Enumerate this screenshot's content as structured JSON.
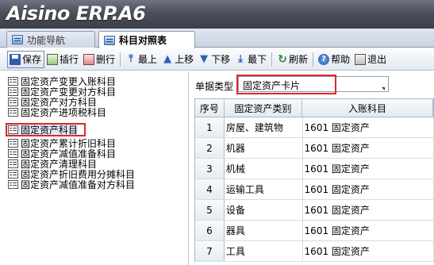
{
  "app": {
    "logo": "Aisino ERP.A6"
  },
  "tabs": [
    {
      "label": "功能导航"
    },
    {
      "label": "科目对照表"
    }
  ],
  "toolbar": {
    "save": "保存",
    "insert": "插行",
    "delete": "删行",
    "top": "最上",
    "up": "上移",
    "down": "下移",
    "bottom": "最下",
    "refresh": "刷新",
    "help": "帮助",
    "exit": "退出"
  },
  "tree": {
    "items": [
      "固定资产变更入账科目",
      "固定资产变更对方科目",
      "固定资产对方科目",
      "固定资产进项税科目",
      "固定资产科目",
      "固定资产累计折旧科目",
      "固定资产减值准备科目",
      "固定资产清理科目",
      "固定资产折旧费用分摊科目",
      "固定资产减值准备对方科目"
    ],
    "selected_index": 4
  },
  "form": {
    "doc_type_label": "单据类型",
    "doc_type_value": "固定资产卡片"
  },
  "grid": {
    "headers": [
      "序号",
      "固定资产类别",
      "入账科目"
    ],
    "rows": [
      [
        "1",
        "房屋、建筑物",
        "1601 固定资产"
      ],
      [
        "2",
        "机器",
        "1601 固定资产"
      ],
      [
        "3",
        "机械",
        "1601 固定资产"
      ],
      [
        "4",
        "运输工具",
        "1601 固定资产"
      ],
      [
        "5",
        "设备",
        "1601 固定资产"
      ],
      [
        "6",
        "器具",
        "1601 固定资产"
      ],
      [
        "7",
        "工具",
        "1601 固定资产"
      ]
    ]
  }
}
